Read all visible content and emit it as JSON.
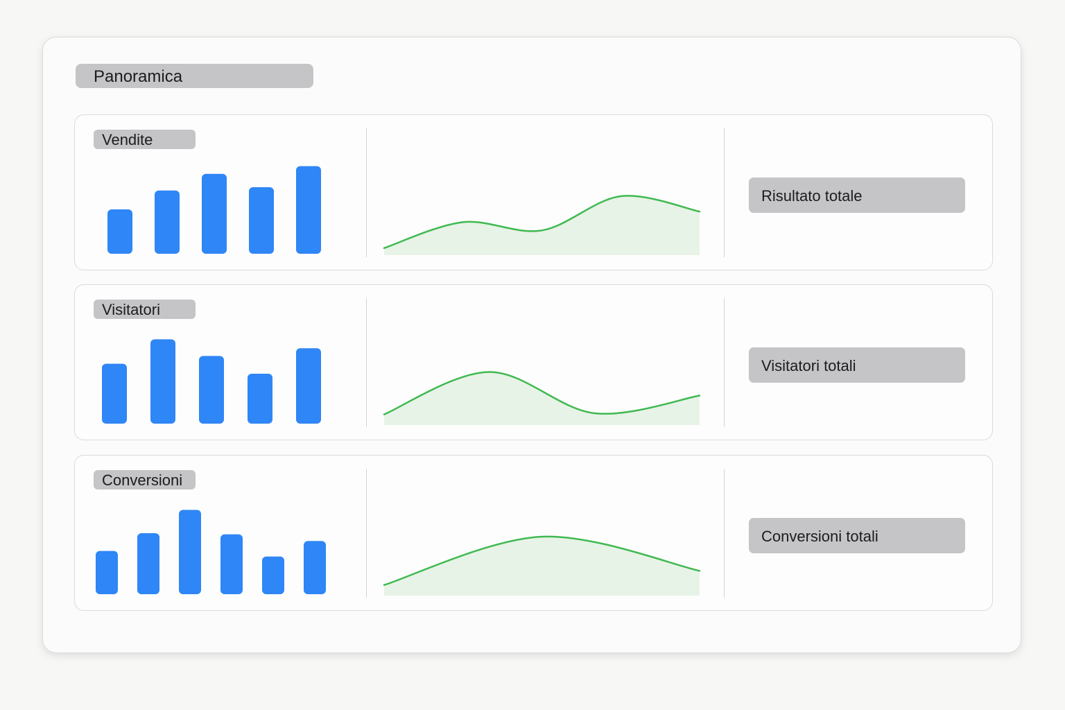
{
  "page": {
    "title": "Panoramica"
  },
  "colors": {
    "bar": "#2f86f6",
    "line": "#3fb950",
    "area": "#e7f3e7",
    "pill": "#c5c5c7"
  },
  "sections": [
    {
      "label": "Vendite",
      "total_label": "Risultato totale",
      "bar_values": [
        4.0,
        5.7,
        7.2,
        6.0,
        7.9
      ],
      "curve_values": [
        0.6,
        2.8,
        2.1,
        5.0,
        3.7
      ]
    },
    {
      "label": "Visitatori",
      "total_label": "Visitatori totali",
      "bar_values": [
        5.4,
        7.6,
        6.1,
        4.5,
        6.8
      ],
      "curve_values": [
        0.9,
        4.5,
        1.0,
        2.5
      ]
    },
    {
      "label": "Conversioni",
      "total_label": "Conversioni totali",
      "bar_values": [
        3.9,
        5.5,
        7.6,
        5.4,
        3.4,
        4.8
      ],
      "curve_values": [
        0.9,
        5.0,
        2.1
      ]
    }
  ]
}
